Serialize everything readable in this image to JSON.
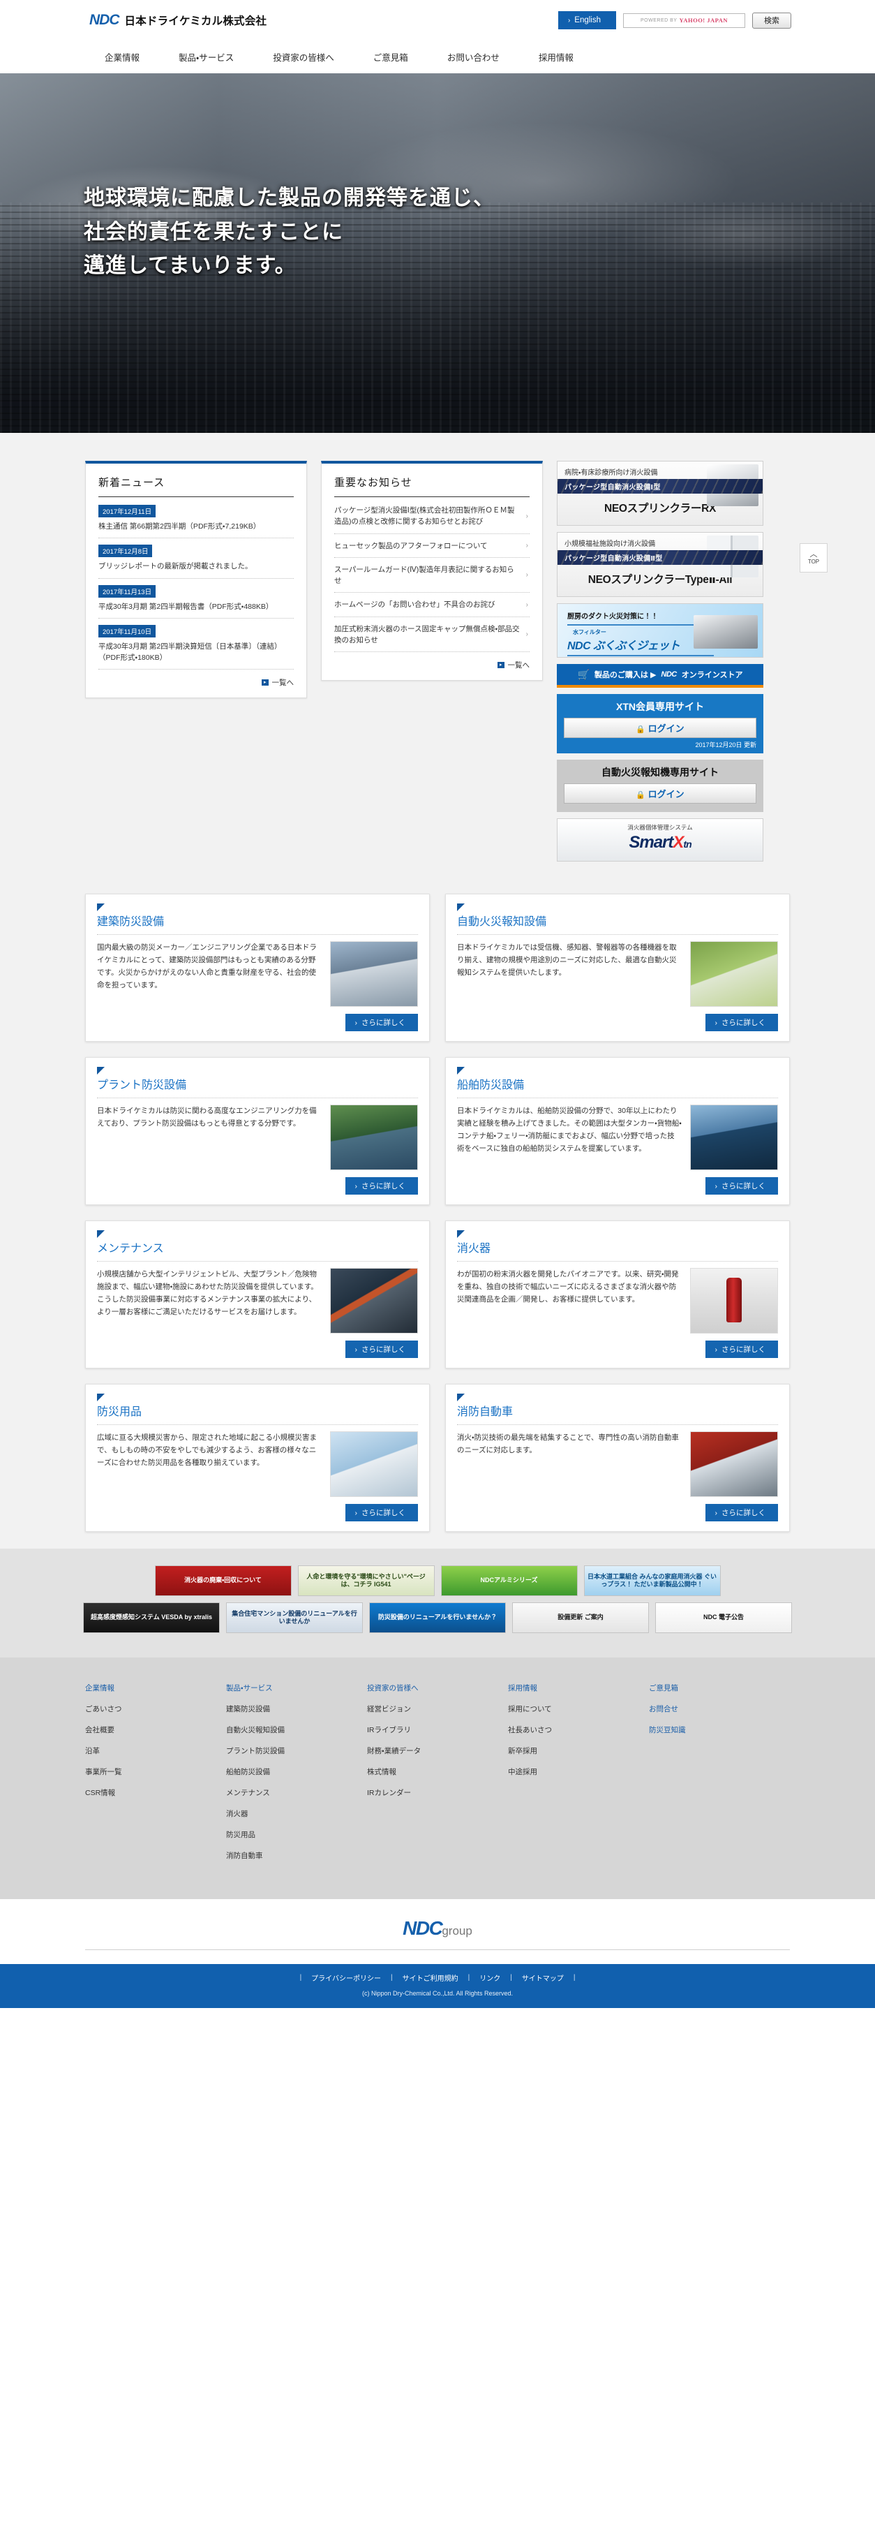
{
  "header": {
    "logo_mark": "NDC",
    "company_name": "日本ドライケミカル株式会社",
    "english_button": "English",
    "english_chevron": "›",
    "search_powered_by": "POWERED BY",
    "search_yahoo": "YAHOO! JAPAN",
    "search_button": "検索",
    "search_placeholder": ""
  },
  "nav": {
    "items": [
      "企業情報",
      "製品・サービス",
      "投資家の皆様へ",
      "ご意見箱",
      "お問い合わせ",
      "採用情報"
    ]
  },
  "hero": {
    "line1": "地球環境に配慮した製品の開発等を通じ、",
    "line2": "社会的責任を果たすことに",
    "line3": "邁進してまいります。"
  },
  "news": {
    "title": "新着ニュース",
    "items": [
      {
        "date": "2017年12月11日",
        "text": "株主通信 第66期第2四半期（PDF形式・7,219KB）"
      },
      {
        "date": "2017年12月8日",
        "text": "ブリッジレポートの最新版が掲載されました。"
      },
      {
        "date": "2017年11月13日",
        "text": "平成30年3月期 第2四半期報告書（PDF形式・488KB）"
      },
      {
        "date": "2017年11月10日",
        "text": "平成30年3月期 第2四半期決算短信〔日本基準〕（連結）（PDF形式・180KB）"
      }
    ],
    "more": "一覧へ"
  },
  "notice": {
    "title": "重要なお知らせ",
    "items": [
      "パッケージ型消火設備Ⅰ型(株式会社初田製作所ＯＥＭ製造品)の点検と改修に関するお知らせとお詫び",
      "ヒューセック製品のアフターフォローについて",
      "スーパールームガード(Ⅳ)製造年月表記に関するお知らせ",
      "ホームページの「お問い合わせ」不具合のお詫び",
      "加圧式粉末消火器のホース固定キャップ無償点検・部品交換のお知らせ"
    ],
    "more": "一覧へ",
    "chevron": "›"
  },
  "rail": {
    "pkg1": {
      "top": "病院・有床診療所向け消火設備",
      "strip": "パッケージ型自動消火設備Ⅰ型",
      "name": "NEOスプリンクラーRX"
    },
    "pkg2": {
      "top": "小規模福祉施設向け消火設備",
      "strip": "パッケージ型自動消火設備Ⅱ型",
      "name": "NEOスプリンクラーTypeⅡ-All"
    },
    "jet": {
      "top": "厨房のダクト火災対策に！！",
      "sub": "水フィルター",
      "main": "NDC ぶくぶくジェット"
    },
    "store": {
      "cart_icon": "cart",
      "label": "製品のご購入は ▶",
      "brand": "NDC",
      "store_name": "オンラインストア"
    },
    "xtn": {
      "title": "XTN会員専用サイト",
      "login": "ログイン",
      "lock_icon": "lock",
      "updated": "2017年12月20日 更新"
    },
    "afa": {
      "title": "自動火災報知機専用サイト",
      "login": "ログイン",
      "lock_icon": "lock"
    },
    "smart": {
      "top": "消火器個体管理システム",
      "logo": "Smart",
      "logo_x": "X",
      "logo_tn": "tn"
    },
    "top_button": {
      "arrow": "︿",
      "label": "TOP"
    }
  },
  "cards": [
    {
      "title": "建築防災設備",
      "text": "国内最大級の防災メーカー／エンジニアリング企業である日本ドライケミカルにとって、建築防災設備部門はもっとも実績のある分野です。火災からかけがえのない人命と貴重な財産を守る、社会的使命を担っています。",
      "button": "さらに詳しく",
      "thumb": "building-photo"
    },
    {
      "title": "自動火災報知設備",
      "text": "日本ドライケミカルでは受信機、感知器、警報器等の各種機器を取り揃え、建物の規模や用途別のニーズに対応した、最適な自動火災報知システムを提供いたします。",
      "button": "さらに詳しく",
      "thumb": "alarm-photo"
    },
    {
      "title": "プラント防災設備",
      "text": "日本ドライケミカルは防災に関わる高度なエンジニアリング力を備えており、プラント防災設備はもっとも得意とする分野です。",
      "button": "さらに詳しく",
      "thumb": "plant-photo"
    },
    {
      "title": "船舶防災設備",
      "text": "日本ドライケミカルは、船舶防災設備の分野で、30年以上にわたり実績と経験を積み上げてきました。その範囲は大型タンカー・貨物船・コンテナ船・フェリー・消防艇にまでおよび、幅広い分野で培った技術をベースに独自の船舶防災システムを提案しています。",
      "button": "さらに詳しく",
      "thumb": "ship-photo"
    },
    {
      "title": "メンテナンス",
      "text": "小規模店舗から大型インテリジェントビル、大型プラント／危険物施設まで、幅広い建物・施設にあわせた防災設備を提供しています。こうした防災設備事業に対応するメンテナンス事業の拡大により、より一層お客様にご満足いただけるサービスをお届けします。",
      "button": "さらに詳しく",
      "thumb": "maintenance-photo"
    },
    {
      "title": "消火器",
      "text": "わが国初の粉末消火器を開発したパイオニアです。以来、研究・開発を重ね、独自の技術で幅広いニーズに応えるさまざまな消火器や防災関連商品を企画／開発し、お客様に提供しています。",
      "button": "さらに詳しく",
      "thumb": "extinguisher-photo"
    },
    {
      "title": "防災用品",
      "text": "広域に亘る大規模災害から、限定された地域に起こる小規模災害まで、もしもの時の不安をやしでも減少するよう、お客様の様々なニーズに合わせた防災用品を各種取り揃えています。",
      "button": "さらに詳しく",
      "thumb": "goods-photo"
    },
    {
      "title": "消防自動車",
      "text": "消火・防災技術の最先端を結集することで、専門性の高い消防自動車のニーズに対応します。",
      "button": "さらに詳しく",
      "thumb": "firetruck-photo"
    }
  ],
  "banner_strip": {
    "row1": [
      "消火器の廃棄・回収について",
      "人命と環境を守る\"環境にやさしい\"ページは、コチラ  IG541",
      "NDCアルミシリーズ",
      "日本水道工業組合 みんなの家庭用消火器 ぐいっプラス！ ただいま新製品公開中！"
    ],
    "row2": [
      "超高感度煙感知システム VESDA by xtralis",
      "集合住宅マンション設備のリニューアルを行いませんか",
      "防災設備のリニューアルを行いませんか？",
      "設備更新 ご案内",
      "NDC 電子公告"
    ]
  },
  "footer": {
    "columns": [
      {
        "head": "企業情報",
        "links": [
          "ごあいさつ",
          "会社概要",
          "沿革",
          "事業所一覧",
          "CSR情報"
        ]
      },
      {
        "head": "製品・サービス",
        "links": [
          "建築防災設備",
          "自動火災報知設備",
          "プラント防災設備",
          "船舶防災設備",
          "メンテナンス",
          "消火器",
          "防災用品",
          "消防自動車"
        ]
      },
      {
        "head": "投資家の皆様へ",
        "links": [
          "経営ビジョン",
          "IRライブラリ",
          "財務・業績データ",
          "株式情報",
          "IRカレンダー"
        ]
      },
      {
        "head": "採用情報",
        "links": [
          "採用について",
          "社長あいさつ",
          "新卒採用",
          "中途採用"
        ]
      },
      {
        "head": "ご意見箱",
        "links": [
          "お問合せ",
          "防災豆知識"
        ]
      }
    ],
    "group_logo": "NDC",
    "group_suffix": "group",
    "bottom_links": [
      "プライバシーポリシー",
      "サイトご利用規約",
      "リンク",
      "サイトマップ"
    ],
    "copyright": "(c) Nippon Dry-Chemical Co.,Ltd. All Rights Reserved."
  }
}
